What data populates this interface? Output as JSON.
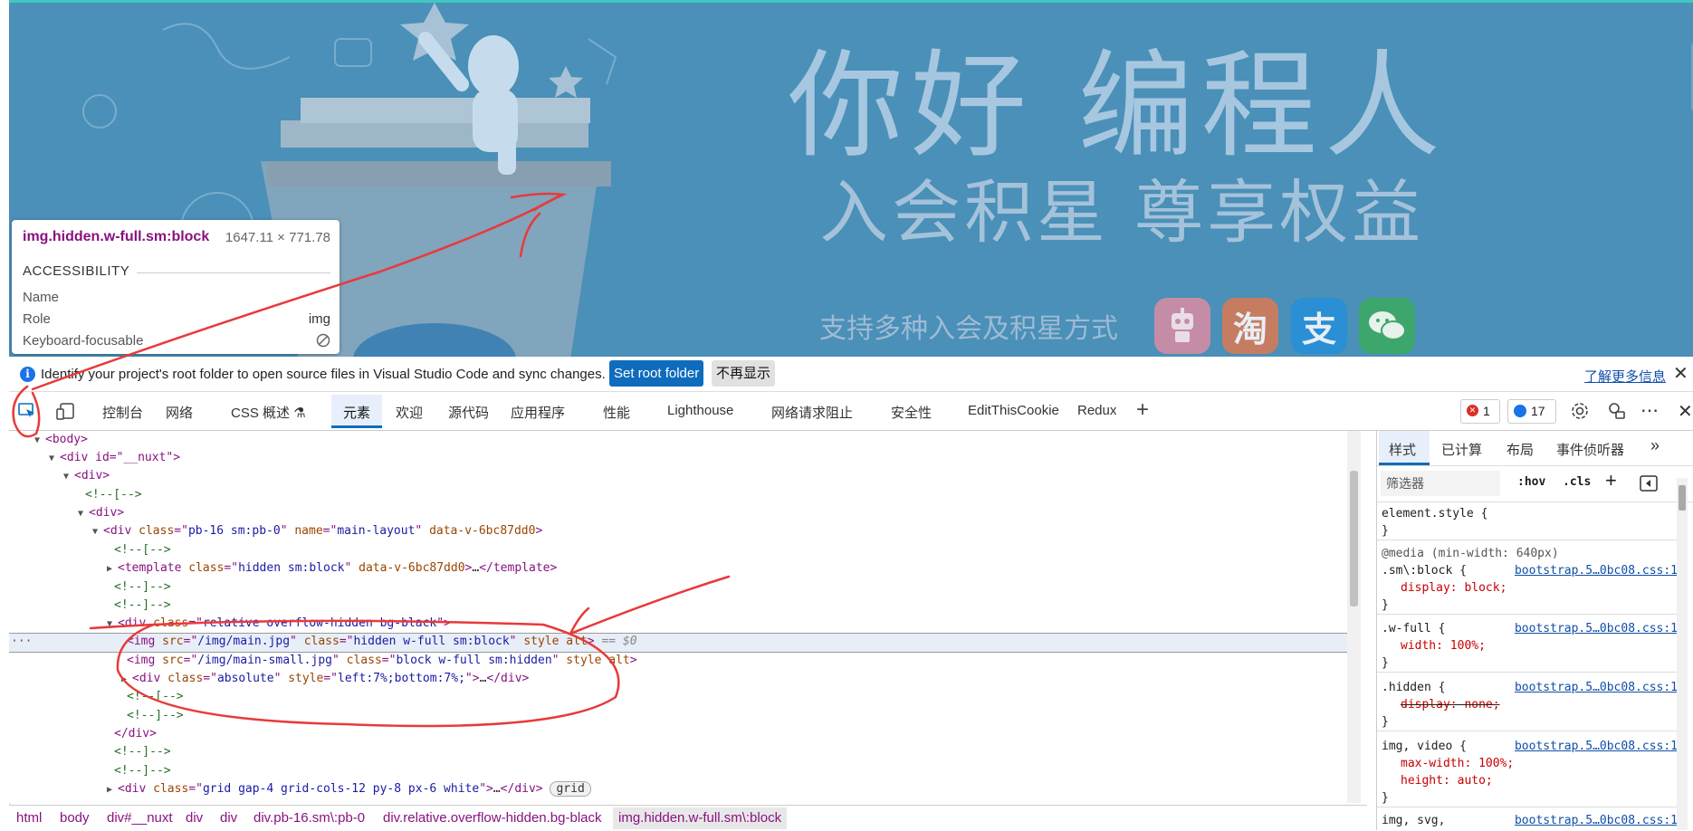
{
  "hero": {
    "title": "你好 编程人",
    "subtitle": "入会积星 尊享权益",
    "tagline": "支持多种入会及积星方式",
    "icons": [
      {
        "name": "robot-icon",
        "glyph": "🤖",
        "bg": "#c88aa6"
      },
      {
        "name": "taobao-icon",
        "glyph": "淘",
        "bg": "#c87a60"
      },
      {
        "name": "alipay-icon",
        "glyph": "支",
        "bg": "#2a8fd4"
      },
      {
        "name": "wechat-icon",
        "glyph": "",
        "bg": "#3aa56a"
      }
    ]
  },
  "tooltip": {
    "selector": "img.hidden.w-full.sm:block",
    "dimensions": "1647.11 × 771.78",
    "section": "ACCESSIBILITY",
    "name_label": "Name",
    "role_label": "Role",
    "role_value": "img",
    "focusable_label": "Keyboard-focusable"
  },
  "infobar": {
    "message": "Identify your project's root folder to open source files in Visual Studio Code and sync changes.",
    "set_root": "Set root folder",
    "dismiss": "不再显示",
    "learn_more": "了解更多信息"
  },
  "toolbar": {
    "tabs": [
      "控制台",
      "网络",
      "CSS 概述",
      "元素",
      "欢迎",
      "源代码",
      "应用程序",
      "性能",
      "Lighthouse",
      "网络请求阻止",
      "安全性",
      "EditThisCookie",
      "Redux"
    ],
    "active_tab": "元素",
    "error_count": "1",
    "message_count": "17"
  },
  "dom": {
    "body": "<body>",
    "nuxt_open": "<div id=\"__nuxt\">",
    "div": "<div>",
    "comment_open": "<!--[-->",
    "comment_close": "<!--]-->",
    "div_end": "</div>",
    "main_class": "pb-16 sm:pb-0",
    "main_name": "main-layout",
    "scope_attr": "data-v-6bc87dd0",
    "template_class": "hidden sm:block",
    "relative_class": "relative overflow-hidden bg-black",
    "img1_src": "/img/main.jpg",
    "img1_class": "hidden w-full sm:block",
    "img2_src": "/img/main-small.jpg",
    "img2_class": "block w-full sm:hidden",
    "abs_class": "absolute",
    "abs_style": "left:7%;bottom:7%;",
    "grid_class": "grid gap-4 grid-cols-12 py-8 px-6 white",
    "grid_badge": "grid",
    "eq_marker": "== $0",
    "ellipsis": "…"
  },
  "styles": {
    "tabs": [
      "样式",
      "已计算",
      "布局",
      "事件侦听器"
    ],
    "filter_placeholder": "筛选器",
    "hov": ":hov",
    "cls": ".cls",
    "element_style": "element.style {",
    "media": "@media (min-width: 640px)",
    "sm_block": ".sm\\:block {",
    "w_full": ".w-full {",
    "hidden": ".hidden {",
    "img_video": "img, video {",
    "img_svg": "img, svg,",
    "source": "bootstrap.5…0bc08.css:1",
    "display_block": "display: block;",
    "width_100": "width: 100%;",
    "display_none": "display: none;",
    "max_width": "max-width: 100%;",
    "height_auto": "height: auto;",
    "close_brace": "}"
  },
  "breadcrumb": [
    "html",
    "body",
    "div#__nuxt",
    "div",
    "div",
    "div.pb-16.sm\\:pb-0",
    "div.relative.overflow-hidden.bg-black",
    "img.hidden.w-full.sm\\:block"
  ],
  "colors": {
    "accent": "#0f6cbd",
    "page_bg": "#4a90b8",
    "annotation": "#e83a3a"
  }
}
